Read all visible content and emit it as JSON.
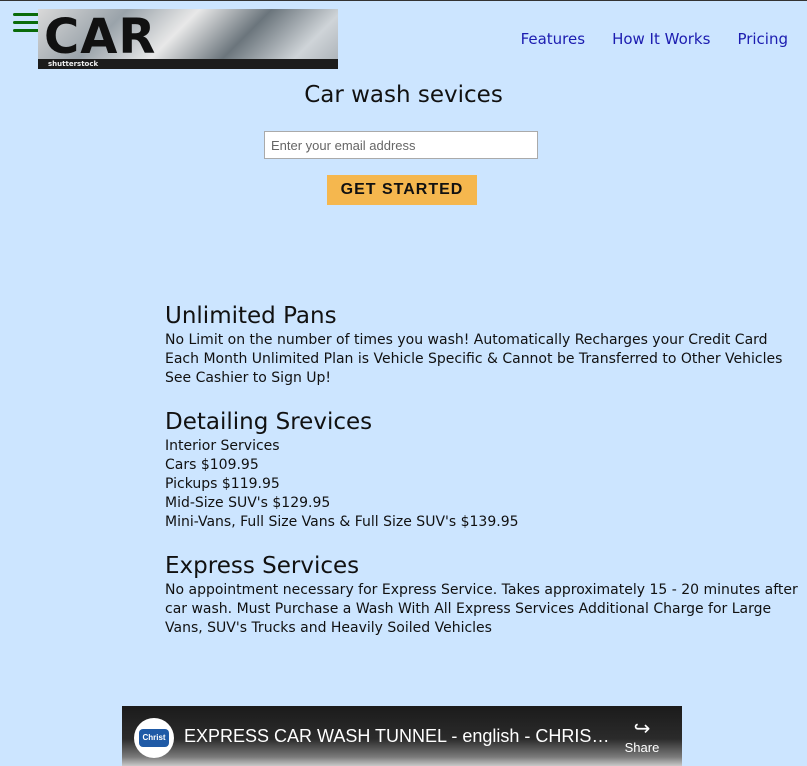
{
  "header": {
    "menu_icon": "hamburger-menu-icon",
    "logo_text": "CAR WASH",
    "logo_watermark": "shutterstock",
    "nav": [
      "Features",
      "How It Works",
      "Pricing"
    ]
  },
  "hero": {
    "title": "Car wash sevices",
    "email_placeholder": "Enter your email address",
    "cta_label": "GET STARTED"
  },
  "sections": {
    "unlimited": {
      "heading": "Unlimited Pans",
      "body": "No Limit on the number of times you wash! Automatically Recharges your Credit Card Each Month Unlimited Plan is Vehicle Specific & Cannot be Transferred to Other Vehicles See Cashier to Sign Up!"
    },
    "detailing": {
      "heading": "Detailing Srevices",
      "lines": [
        "Interior Services",
        "Cars $109.95",
        "Pickups $119.95",
        "Mid-Size SUV's $129.95",
        "Mini-Vans, Full Size Vans & Full Size SUV's $139.95"
      ]
    },
    "express": {
      "heading": "Express Services",
      "body": "No appointment necessary for Express Service. Takes approximately 15 - 20 minutes after car wash. Must Purchase a Wash With All Express Services Additional Charge for Large Vans, SUV's Trucks and Heavily Soiled Vehicles"
    }
  },
  "video": {
    "channel_logo_text": "Christ",
    "title": "EXPRESS CAR WASH TUNNEL - english - CHRIST W...",
    "share_label": "Share",
    "share_icon": "share-arrow-icon"
  },
  "colors": {
    "background": "#cce5ff",
    "nav_link": "#1c1cb0",
    "cta": "#f5b74e",
    "menu_icon": "#0a6b0a"
  }
}
